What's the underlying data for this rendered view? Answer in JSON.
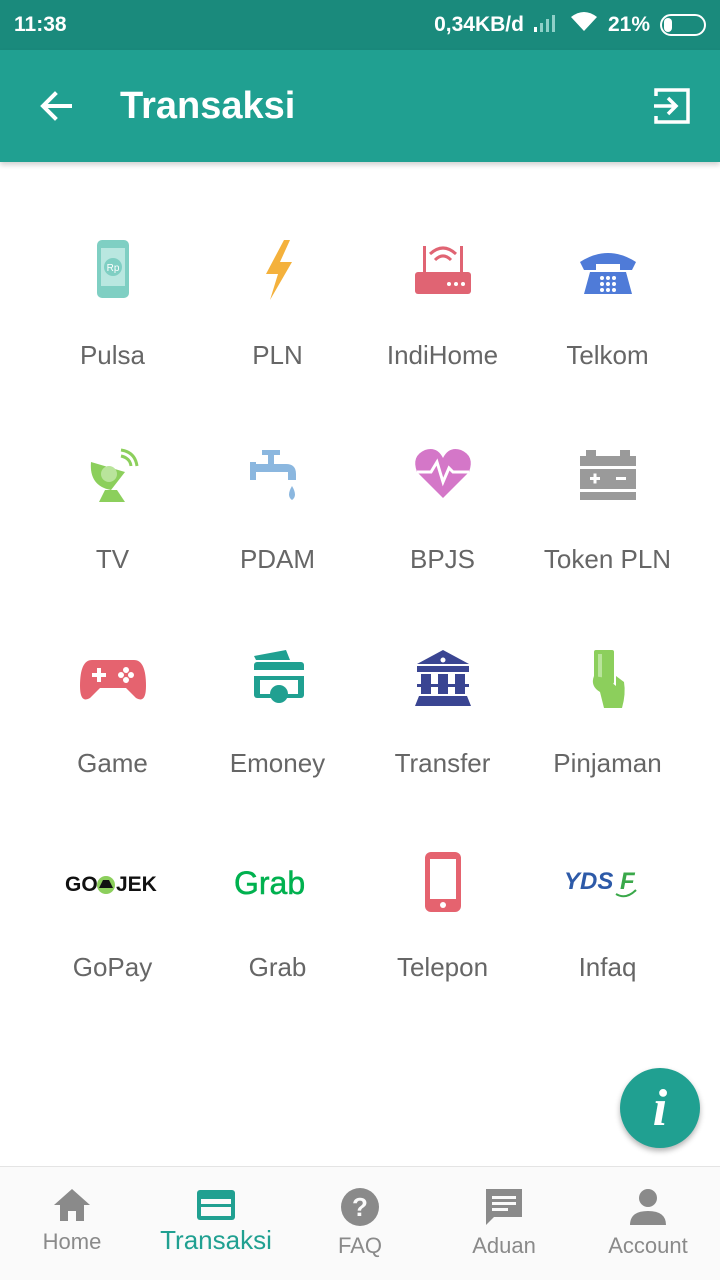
{
  "status_bar": {
    "time": "11:38",
    "network_speed": "0,34KB/d",
    "battery": "21%"
  },
  "app_bar": {
    "title": "Transaksi",
    "back_icon": "arrow-back-icon",
    "exit_icon": "exit-icon"
  },
  "menu": [
    {
      "label": "Pulsa",
      "icon": "phone-pulsa-icon"
    },
    {
      "label": "PLN",
      "icon": "lightning-icon"
    },
    {
      "label": "IndiHome",
      "icon": "router-icon"
    },
    {
      "label": "Telkom",
      "icon": "telephone-icon"
    },
    {
      "label": "TV",
      "icon": "satellite-dish-icon"
    },
    {
      "label": "PDAM",
      "icon": "water-tap-icon"
    },
    {
      "label": "BPJS",
      "icon": "heart-pulse-icon"
    },
    {
      "label": "Token PLN",
      "icon": "battery-token-icon"
    },
    {
      "label": "Game",
      "icon": "gamepad-icon"
    },
    {
      "label": "Emoney",
      "icon": "card-icon"
    },
    {
      "label": "Transfer",
      "icon": "bank-icon"
    },
    {
      "label": "Pinjaman",
      "icon": "hand-card-icon"
    },
    {
      "label": "GoPay",
      "icon": "gojek-logo",
      "logo_text": "GO-JEK"
    },
    {
      "label": "Grab",
      "icon": "grab-logo",
      "logo_text": "Grab"
    },
    {
      "label": "Telepon",
      "icon": "mobile-phone-icon"
    },
    {
      "label": "Infaq",
      "icon": "yds-logo",
      "logo_text": "YDSF"
    }
  ],
  "fab": {
    "label": "i",
    "icon": "info-icon"
  },
  "bottom_nav": [
    {
      "label": "Home",
      "icon": "home-icon",
      "active": false
    },
    {
      "label": "Transaksi",
      "icon": "payment-card-icon",
      "active": true
    },
    {
      "label": "FAQ",
      "icon": "help-icon",
      "active": false
    },
    {
      "label": "Aduan",
      "icon": "chat-icon",
      "active": false
    },
    {
      "label": "Account",
      "icon": "person-icon",
      "active": false
    }
  ],
  "colors": {
    "primary": "#20a091",
    "status_bar": "#1a8a7c",
    "label_gray": "#666666",
    "nav_gray": "#8a8a8a"
  }
}
